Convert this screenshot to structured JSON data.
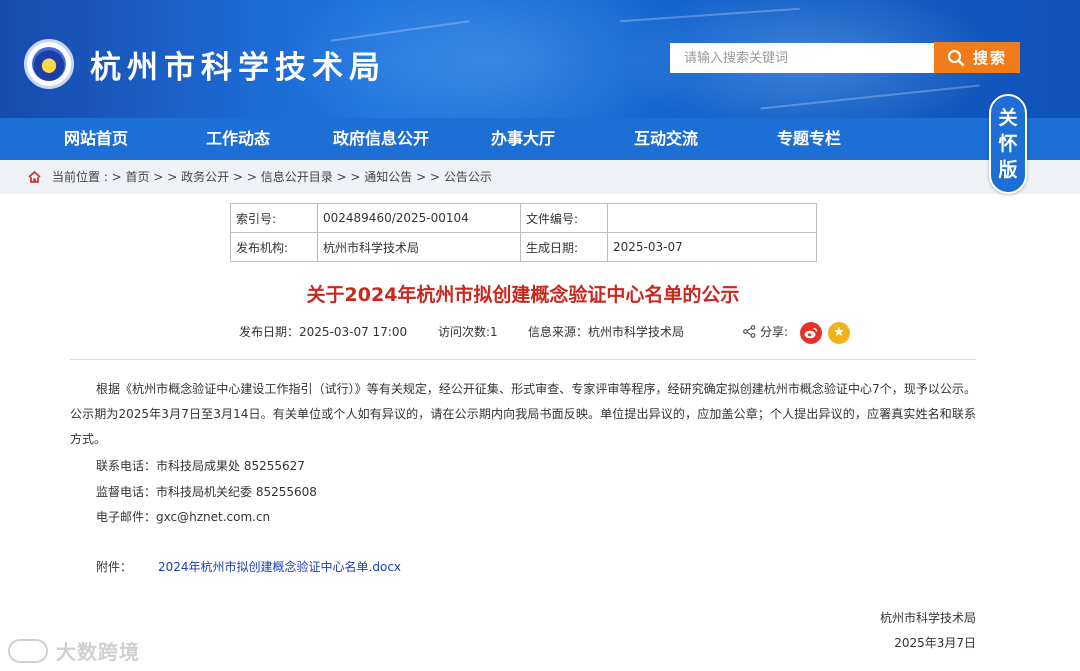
{
  "header": {
    "site_title": "杭州市科学技术局",
    "search_placeholder": "请输入搜索关键词",
    "search_button": "搜索",
    "care_mode": [
      "关",
      "怀",
      "版"
    ]
  },
  "nav": {
    "items": [
      "网站首页",
      "工作动态",
      "政府信息公开",
      "办事大厅",
      "互动交流",
      "专题专栏"
    ]
  },
  "breadcrumb": {
    "prefix": "当前位置 : > ",
    "items": [
      "首页",
      "政务公开",
      "信息公开目录",
      "通知公告",
      "公告公示"
    ],
    "separator": " > > "
  },
  "meta": {
    "index_label": "索引号:",
    "index_value": "002489460/2025-00104",
    "doc_no_label": "文件编号:",
    "doc_no_value": "",
    "publisher_label": "发布机构:",
    "publisher_value": "杭州市科学技术局",
    "date_label": "生成日期:",
    "date_value": "2025-03-07"
  },
  "article": {
    "title": "关于2024年杭州市拟创建概念验证中心名单的公示",
    "publish_date": "发布日期：2025-03-07 17:00",
    "visits": "访问次数:1",
    "source": "信息来源：杭州市科学技术局",
    "share_label": "分享:",
    "body": "根据《杭州市概念验证中心建设工作指引（试行）》等有关规定，经公开征集、形式审查、专家评审等程序，经研究确定拟创建杭州市概念验证中心7个，现予以公示。公示期为2025年3月7日至3月14日。有关单位或个人如有异议的，请在公示期内向我局书面反映。单位提出异议的，应加盖公章；个人提出异议的，应署真实姓名和联系方式。",
    "contact_phone": "联系电话：市科技局成果处 85255627",
    "supervise_phone": "监督电话：市科技局机关纪委 85255608",
    "email": "电子邮件：gxc@hznet.com.cn",
    "attachment_label": "附件：",
    "attachment_name": "2024年杭州市拟创建概念验证中心名单.docx",
    "sign_org": "杭州市科学技术局",
    "sign_date": "2025年3月7日"
  },
  "watermark": "大数跨境",
  "colors": {
    "nav_blue": "#1d6fd6",
    "search_orange": "#f07d1a",
    "title_red": "#c8281e",
    "link_blue": "#1a3fb7"
  }
}
